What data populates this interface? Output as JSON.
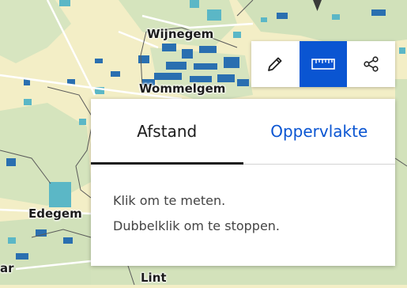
{
  "map": {
    "places": [
      "Wijnegem",
      "Wommelgem",
      "Edegem",
      "Lint",
      "ar"
    ]
  },
  "toolbar": {
    "tools": [
      {
        "icon": "pencil-icon",
        "active": false
      },
      {
        "icon": "ruler-icon",
        "active": true
      },
      {
        "icon": "share-icon",
        "active": false
      }
    ]
  },
  "measure_panel": {
    "tabs": [
      {
        "label": "Afstand",
        "active": true
      },
      {
        "label": "Oppervlakte",
        "active": false
      }
    ],
    "instructions": [
      "Klik om te meten.",
      "Dubbelklik om te stoppen."
    ]
  },
  "colors": {
    "accent": "#0a55d2",
    "map_background": "#f3eec6",
    "map_green": "#d1e1ba",
    "map_water_dark": "#2a6fb0",
    "map_water_teal": "#5bb7c6",
    "map_contour": "#5a5a5a"
  }
}
